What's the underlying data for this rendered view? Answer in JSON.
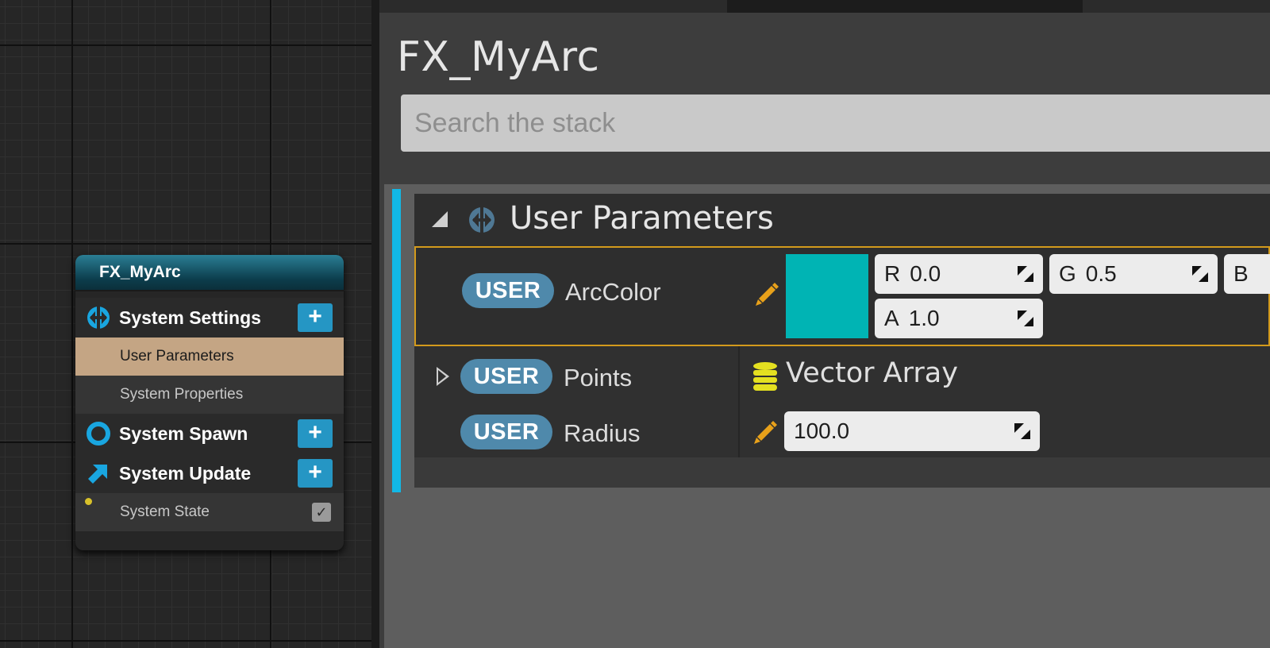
{
  "graph": {
    "node": {
      "title": "FX_MyArc",
      "groups": {
        "settings": {
          "label": "System Settings",
          "icon": "system-settings-icon",
          "button": "+"
        },
        "spawn": {
          "label": "System Spawn",
          "icon": "system-spawn-icon",
          "button": "+"
        },
        "update": {
          "label": "System Update",
          "icon": "system-update-icon",
          "button": "+"
        }
      },
      "items": {
        "user_parameters": "User Parameters",
        "system_properties": "System Properties",
        "system_state": "System State"
      },
      "system_state_checked": true
    }
  },
  "stack": {
    "title": "FX_MyArc",
    "search": {
      "placeholder": "Search the stack",
      "value": ""
    },
    "section": {
      "title": "User Parameters",
      "icon": "system-settings-icon",
      "collapse_glyph": "◢"
    },
    "params": [
      {
        "badge": "USER",
        "name": "ArcColor",
        "type": "color",
        "swatch_color": "#00b4b4",
        "fields": [
          {
            "label": "R",
            "value": "0.0"
          },
          {
            "label": "G",
            "value": "0.5"
          },
          {
            "label": "B",
            "value": ""
          },
          {
            "label": "A",
            "value": "1.0"
          }
        ]
      },
      {
        "badge": "USER",
        "name": "Points",
        "type": "array",
        "value": "Vector Array",
        "icon": "database-icon"
      },
      {
        "badge": "USER",
        "name": "Radius",
        "type": "float",
        "value": "100.0"
      }
    ]
  },
  "colors": {
    "accent_cyan": "#12b8e6",
    "selection_outline": "#d39a1c",
    "selected_item": "#c4a584",
    "user_badge": "#4f89ab",
    "pencil": "#e8a11a",
    "array_icon": "#e4e020"
  }
}
